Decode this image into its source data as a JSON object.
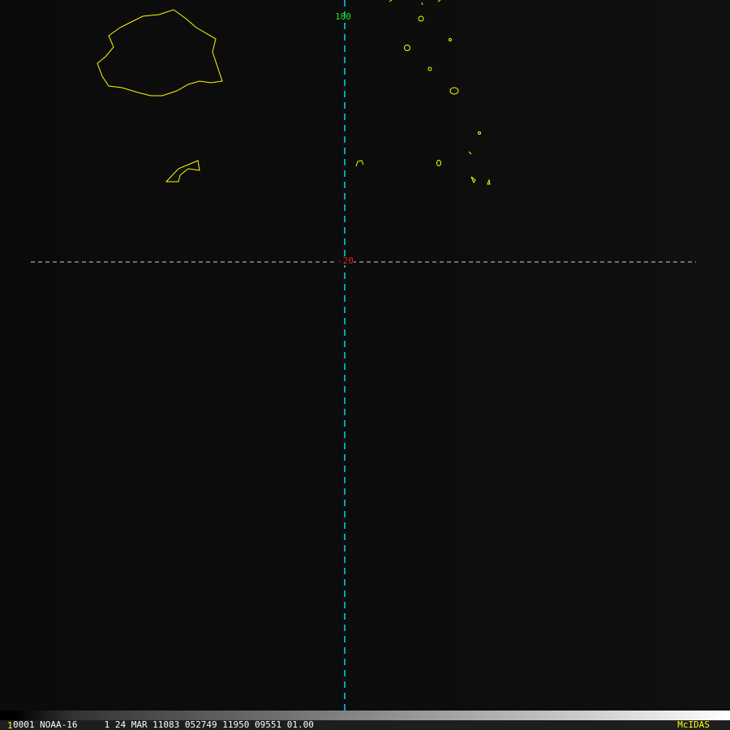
{
  "map": {
    "longitude_label": "180",
    "latitude_label": "-20",
    "colors": {
      "coast": "#ffff00",
      "lon_line": "#00d8e8",
      "lat_line": "#cccccc",
      "lon_label": "#22e022",
      "lat_label": "#e02020"
    }
  },
  "status_bar": {
    "frame": "1",
    "info": "0001 NOAA-16     1 24 MAR 11083 052749 11950 09551 01.00",
    "brand": "McIDAS"
  }
}
